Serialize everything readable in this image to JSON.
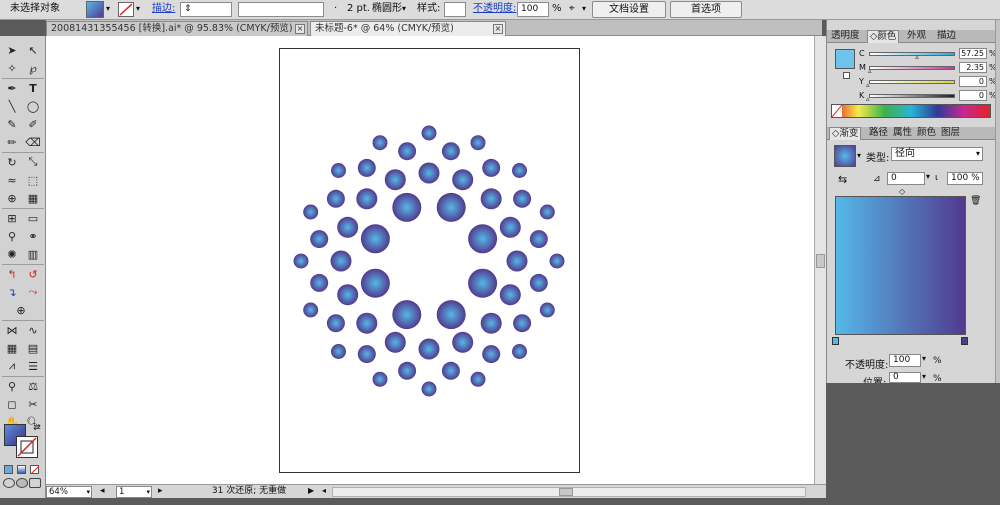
{
  "control_bar": {
    "selection_status": "未选择对象",
    "stroke_link": "描边:",
    "stroke_weight": "2 pt.",
    "brush": "椭圆形",
    "style_label": "样式:",
    "opacity_link": "不透明度:",
    "opacity_value": "100",
    "opacity_unit": "%",
    "doc_setup_button": "文档设置",
    "preferences_button": "首选项"
  },
  "tabs": [
    {
      "label": "20081431355456 [转换].ai* @ 95.83% (CMYK/预览)"
    },
    {
      "label": "未标题-6* @ 64% (CMYK/预览)"
    }
  ],
  "status": {
    "zoom": "64%",
    "page": "1",
    "undo_info": "31 次还原; 无重做"
  },
  "color_panel": {
    "tabs": [
      "透明度",
      "颜色",
      "外观",
      "描边"
    ],
    "active_tab": "颜色",
    "channels": [
      {
        "label": "C",
        "value": "57.25",
        "fraction": 0.5725,
        "color": "#1faee0"
      },
      {
        "label": "M",
        "value": "2.35",
        "fraction": 0.0235,
        "color": "#c43a9a"
      },
      {
        "label": "Y",
        "value": "0",
        "fraction": 0,
        "color": "#d6d63a"
      },
      {
        "label": "K",
        "value": "0",
        "fraction": 0,
        "color": "#222222"
      }
    ],
    "fill_color": "#6dc3ec"
  },
  "gradient_panel": {
    "tabs": [
      "渐变",
      "路径",
      "属性",
      "颜色",
      "图层"
    ],
    "active_tab": "渐变",
    "type_label": "类型:",
    "type_value": "径向",
    "angle_value": "0",
    "aspect_value": "100",
    "aspect_unit": "%",
    "start_color": "#55b8e8",
    "end_color": "#523a8e",
    "opacity_label": "不透明度:",
    "opacity_value": "100",
    "opacity_unit": "%",
    "position_label": "位置:",
    "position_value": "0",
    "position_unit": "%"
  }
}
